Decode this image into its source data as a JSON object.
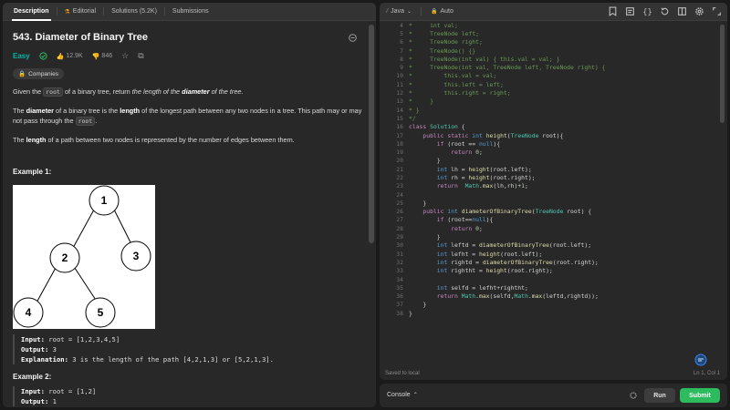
{
  "tabs": [
    {
      "label": "Description"
    },
    {
      "label": "Editorial"
    },
    {
      "label": "Solutions (5.2K)"
    },
    {
      "label": "Submissions"
    }
  ],
  "problem": {
    "title": "543. Diameter of Binary Tree",
    "difficulty": "Easy",
    "likes": "12.9K",
    "dislikes": "846",
    "companies_label": "Companies"
  },
  "description": {
    "p1_prefix": "Given the ",
    "p1_code": "root",
    "p1_mid": " of a binary tree, return ",
    "p1_em1": "the length of the ",
    "p1_em_b": "diameter",
    "p1_em2": " of the tree.",
    "p2_b1": "diameter",
    "p2_a": "The ",
    "p2_b": " of a binary tree is the ",
    "p2_b2": "length",
    "p2_c": " of the longest path between any two nodes in a tree. This path may or may not pass through the ",
    "p2_code": "root",
    "p2_d": ".",
    "p3_a": "The ",
    "p3_b": "length",
    "p3_c": " of a path between two nodes is represented by the number of edges between them."
  },
  "example1": {
    "heading": "Example 1:",
    "input_label": "Input:",
    "input_value": "root = [1,2,3,4,5]",
    "output_label": "Output:",
    "output_value": "3",
    "explanation_label": "Explanation:",
    "explanation_value": "3 is the length of the path [4,2,1,3] or [5,2,1,3]."
  },
  "example2": {
    "heading": "Example 2:",
    "input_label": "Input:",
    "input_value": "root = [1,2]",
    "output_label": "Output:",
    "output_value": "1"
  },
  "tree_nodes": [
    "1",
    "2",
    "3",
    "4",
    "5"
  ],
  "editor": {
    "language": "Java",
    "mode": "Auto",
    "status": "Saved to local",
    "cursor": "Ln 1, Col 1",
    "lines": [
      {
        "n": "4",
        "s": "*     int val;"
      },
      {
        "n": "5",
        "s": "*     TreeNode left;"
      },
      {
        "n": "6",
        "s": "*     TreeNode right;"
      },
      {
        "n": "7",
        "s": "*     TreeNode() {}"
      },
      {
        "n": "8",
        "s": "*     TreeNode(int val) { this.val = val; }"
      },
      {
        "n": "9",
        "s": "*     TreeNode(int val, TreeNode left, TreeNode right) {"
      },
      {
        "n": "10",
        "s": "*         this.val = val;"
      },
      {
        "n": "11",
        "s": "*         this.left = left;"
      },
      {
        "n": "12",
        "s": "*         this.right = right;"
      },
      {
        "n": "13",
        "s": "*     }"
      },
      {
        "n": "14",
        "s": "* }"
      },
      {
        "n": "15",
        "s": "*/"
      },
      {
        "n": "16",
        "s": "class Solution {"
      },
      {
        "n": "17",
        "s": "    public static int height(TreeNode root){"
      },
      {
        "n": "18",
        "s": "        if (root == null){"
      },
      {
        "n": "19",
        "s": "            return 0;"
      },
      {
        "n": "20",
        "s": "        }"
      },
      {
        "n": "21",
        "s": "        int lh = height(root.left);"
      },
      {
        "n": "22",
        "s": "        int rh = height(root.right);"
      },
      {
        "n": "23",
        "s": "        return  Math.max(lh,rh)+1;"
      },
      {
        "n": "24",
        "s": ""
      },
      {
        "n": "25",
        "s": "    }"
      },
      {
        "n": "26",
        "s": "    public int diameterOfBinaryTree(TreeNode root) {"
      },
      {
        "n": "27",
        "s": "        if (root==null){"
      },
      {
        "n": "28",
        "s": "            return 0;"
      },
      {
        "n": "29",
        "s": "        }"
      },
      {
        "n": "30",
        "s": "        int leftd = diameterOfBinaryTree(root.left);"
      },
      {
        "n": "31",
        "s": "        int lefht = height(root.left);"
      },
      {
        "n": "32",
        "s": "        int rightd = diameterOfBinaryTree(root.right);"
      },
      {
        "n": "33",
        "s": "        int rightht = height(root.right);"
      },
      {
        "n": "34",
        "s": ""
      },
      {
        "n": "35",
        "s": "        int selfd = lefht+rightht;"
      },
      {
        "n": "36",
        "s": "        return Math.max(selfd,Math.max(leftd,rightd));"
      },
      {
        "n": "37",
        "s": "    }"
      },
      {
        "n": "38",
        "s": "}"
      }
    ]
  },
  "console": {
    "label": "Console",
    "run_label": "Run",
    "submit_label": "Submit"
  },
  "colors": {
    "accent_green": "#2cbb5d",
    "easy": "#00b8a3",
    "orange": "#ffa116"
  }
}
